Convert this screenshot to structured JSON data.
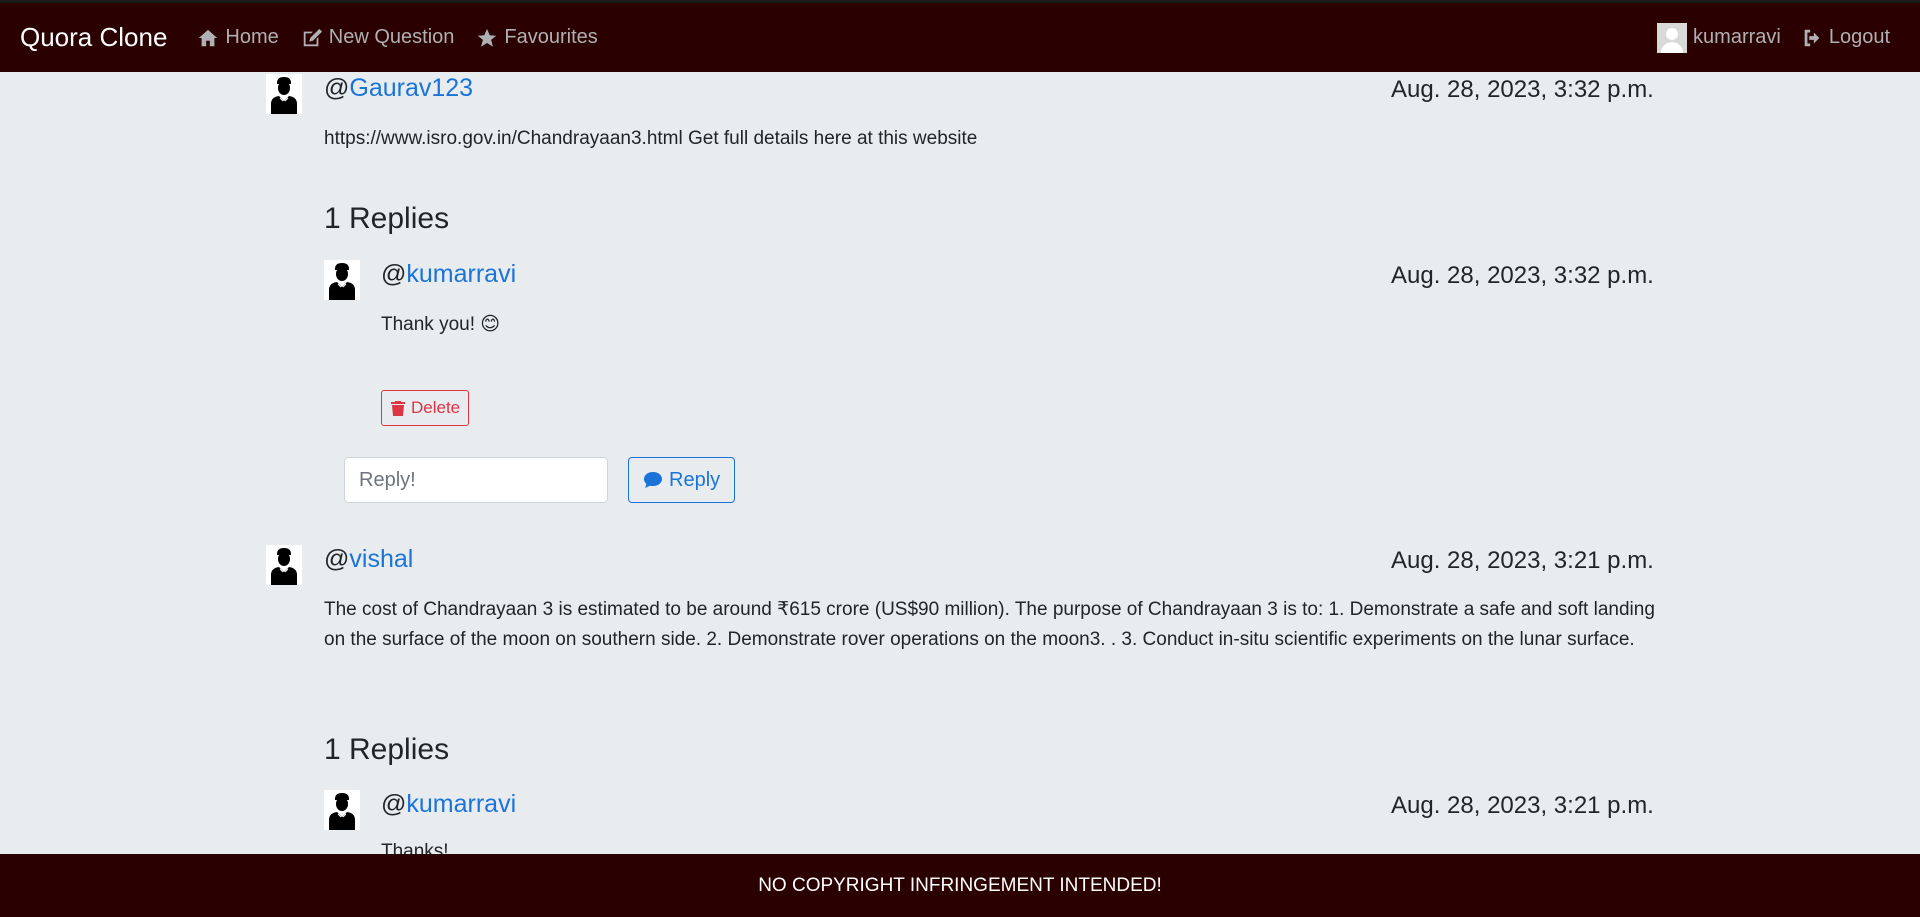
{
  "navbar": {
    "brand": "Quora Clone",
    "links": [
      {
        "label": "Home",
        "icon": "home-icon"
      },
      {
        "label": "New Question",
        "icon": "edit-icon"
      },
      {
        "label": "Favourites",
        "icon": "star-icon"
      }
    ],
    "user": "kumarravi",
    "logout": "Logout"
  },
  "comments": [
    {
      "handle_prefix": "@",
      "username": "Gaurav123",
      "time": "Aug. 28, 2023, 3:32 p.m.",
      "text": "https://www.isro.gov.in/Chandrayaan3.html Get full details here at this website",
      "replies_title": "1 Replies",
      "reply": {
        "handle_prefix": "@",
        "username": "kumarravi",
        "time": "Aug. 28, 2023, 3:32 p.m.",
        "text": "Thank you! 😊",
        "delete_label": "Delete"
      },
      "reply_placeholder": "Reply!",
      "reply_button": "Reply"
    },
    {
      "handle_prefix": "@",
      "username": "vishal",
      "time": "Aug. 28, 2023, 3:21 p.m.",
      "text": "The cost of Chandrayaan 3 is estimated to be around ₹615 crore (US$90 million). The purpose of Chandrayaan 3 is to: 1. Demonstrate a safe and soft landing on the surface of the moon on southern side. 2. Demonstrate rover operations on the moon3. . 3. Conduct in-situ scientific experiments on the lunar surface.",
      "replies_title": "1 Replies",
      "reply": {
        "handle_prefix": "@",
        "username": "kumarravi",
        "time": "Aug. 28, 2023, 3:21 p.m.",
        "text": "Thanks!"
      }
    }
  ],
  "footer": "NO COPYRIGHT INFRINGEMENT INTENDED!"
}
